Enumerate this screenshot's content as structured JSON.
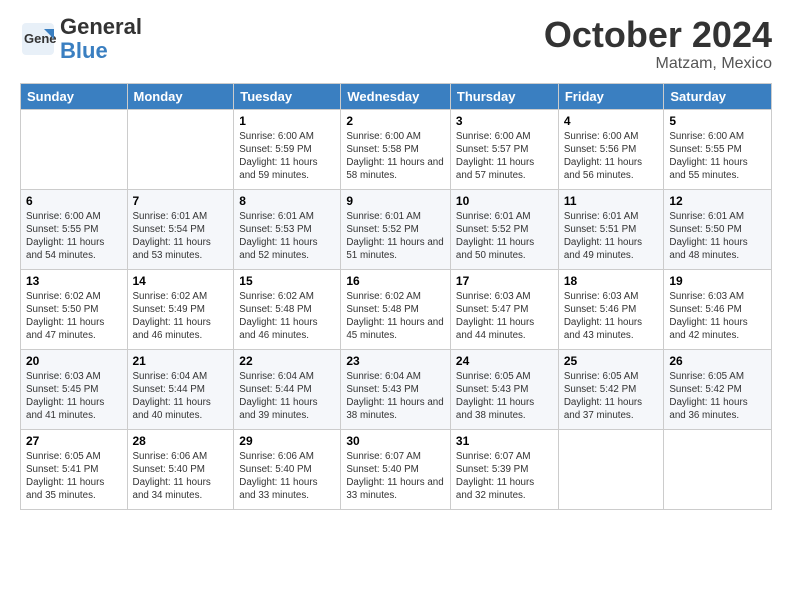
{
  "header": {
    "logo_general": "General",
    "logo_blue": "Blue",
    "month": "October 2024",
    "location": "Matzam, Mexico"
  },
  "weekdays": [
    "Sunday",
    "Monday",
    "Tuesday",
    "Wednesday",
    "Thursday",
    "Friday",
    "Saturday"
  ],
  "weeks": [
    [
      {
        "day": "",
        "detail": ""
      },
      {
        "day": "",
        "detail": ""
      },
      {
        "day": "1",
        "detail": "Sunrise: 6:00 AM\nSunset: 5:59 PM\nDaylight: 11 hours and 59 minutes."
      },
      {
        "day": "2",
        "detail": "Sunrise: 6:00 AM\nSunset: 5:58 PM\nDaylight: 11 hours and 58 minutes."
      },
      {
        "day": "3",
        "detail": "Sunrise: 6:00 AM\nSunset: 5:57 PM\nDaylight: 11 hours and 57 minutes."
      },
      {
        "day": "4",
        "detail": "Sunrise: 6:00 AM\nSunset: 5:56 PM\nDaylight: 11 hours and 56 minutes."
      },
      {
        "day": "5",
        "detail": "Sunrise: 6:00 AM\nSunset: 5:55 PM\nDaylight: 11 hours and 55 minutes."
      }
    ],
    [
      {
        "day": "6",
        "detail": "Sunrise: 6:00 AM\nSunset: 5:55 PM\nDaylight: 11 hours and 54 minutes."
      },
      {
        "day": "7",
        "detail": "Sunrise: 6:01 AM\nSunset: 5:54 PM\nDaylight: 11 hours and 53 minutes."
      },
      {
        "day": "8",
        "detail": "Sunrise: 6:01 AM\nSunset: 5:53 PM\nDaylight: 11 hours and 52 minutes."
      },
      {
        "day": "9",
        "detail": "Sunrise: 6:01 AM\nSunset: 5:52 PM\nDaylight: 11 hours and 51 minutes."
      },
      {
        "day": "10",
        "detail": "Sunrise: 6:01 AM\nSunset: 5:52 PM\nDaylight: 11 hours and 50 minutes."
      },
      {
        "day": "11",
        "detail": "Sunrise: 6:01 AM\nSunset: 5:51 PM\nDaylight: 11 hours and 49 minutes."
      },
      {
        "day": "12",
        "detail": "Sunrise: 6:01 AM\nSunset: 5:50 PM\nDaylight: 11 hours and 48 minutes."
      }
    ],
    [
      {
        "day": "13",
        "detail": "Sunrise: 6:02 AM\nSunset: 5:50 PM\nDaylight: 11 hours and 47 minutes."
      },
      {
        "day": "14",
        "detail": "Sunrise: 6:02 AM\nSunset: 5:49 PM\nDaylight: 11 hours and 46 minutes."
      },
      {
        "day": "15",
        "detail": "Sunrise: 6:02 AM\nSunset: 5:48 PM\nDaylight: 11 hours and 46 minutes."
      },
      {
        "day": "16",
        "detail": "Sunrise: 6:02 AM\nSunset: 5:48 PM\nDaylight: 11 hours and 45 minutes."
      },
      {
        "day": "17",
        "detail": "Sunrise: 6:03 AM\nSunset: 5:47 PM\nDaylight: 11 hours and 44 minutes."
      },
      {
        "day": "18",
        "detail": "Sunrise: 6:03 AM\nSunset: 5:46 PM\nDaylight: 11 hours and 43 minutes."
      },
      {
        "day": "19",
        "detail": "Sunrise: 6:03 AM\nSunset: 5:46 PM\nDaylight: 11 hours and 42 minutes."
      }
    ],
    [
      {
        "day": "20",
        "detail": "Sunrise: 6:03 AM\nSunset: 5:45 PM\nDaylight: 11 hours and 41 minutes."
      },
      {
        "day": "21",
        "detail": "Sunrise: 6:04 AM\nSunset: 5:44 PM\nDaylight: 11 hours and 40 minutes."
      },
      {
        "day": "22",
        "detail": "Sunrise: 6:04 AM\nSunset: 5:44 PM\nDaylight: 11 hours and 39 minutes."
      },
      {
        "day": "23",
        "detail": "Sunrise: 6:04 AM\nSunset: 5:43 PM\nDaylight: 11 hours and 38 minutes."
      },
      {
        "day": "24",
        "detail": "Sunrise: 6:05 AM\nSunset: 5:43 PM\nDaylight: 11 hours and 38 minutes."
      },
      {
        "day": "25",
        "detail": "Sunrise: 6:05 AM\nSunset: 5:42 PM\nDaylight: 11 hours and 37 minutes."
      },
      {
        "day": "26",
        "detail": "Sunrise: 6:05 AM\nSunset: 5:42 PM\nDaylight: 11 hours and 36 minutes."
      }
    ],
    [
      {
        "day": "27",
        "detail": "Sunrise: 6:05 AM\nSunset: 5:41 PM\nDaylight: 11 hours and 35 minutes."
      },
      {
        "day": "28",
        "detail": "Sunrise: 6:06 AM\nSunset: 5:40 PM\nDaylight: 11 hours and 34 minutes."
      },
      {
        "day": "29",
        "detail": "Sunrise: 6:06 AM\nSunset: 5:40 PM\nDaylight: 11 hours and 33 minutes."
      },
      {
        "day": "30",
        "detail": "Sunrise: 6:07 AM\nSunset: 5:40 PM\nDaylight: 11 hours and 33 minutes."
      },
      {
        "day": "31",
        "detail": "Sunrise: 6:07 AM\nSunset: 5:39 PM\nDaylight: 11 hours and 32 minutes."
      },
      {
        "day": "",
        "detail": ""
      },
      {
        "day": "",
        "detail": ""
      }
    ]
  ]
}
